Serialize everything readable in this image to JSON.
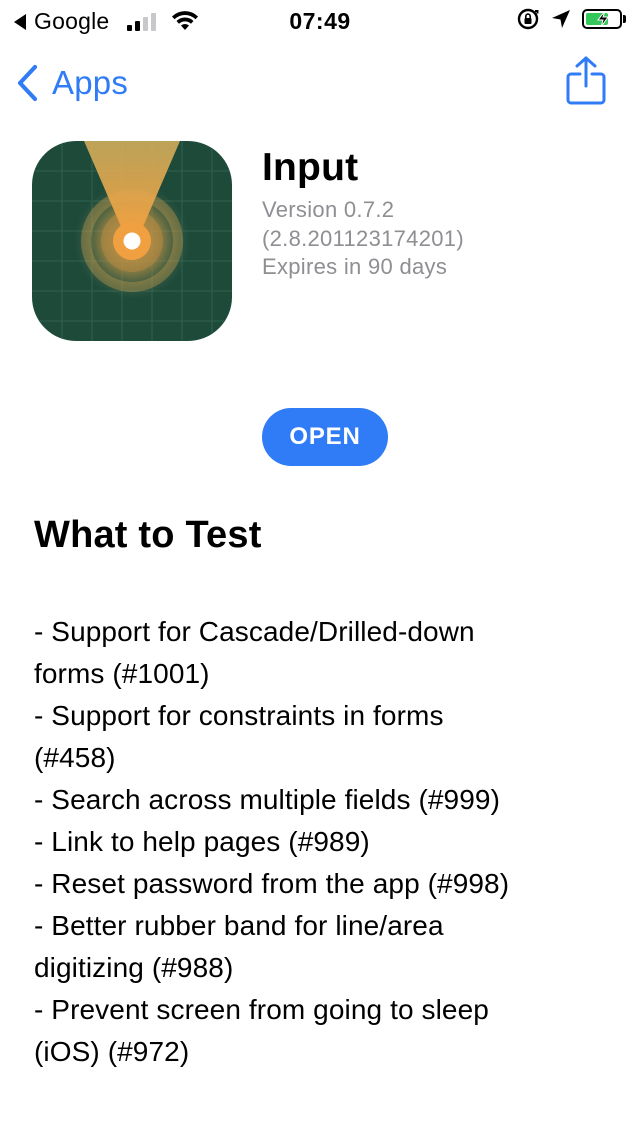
{
  "status_bar": {
    "back_app": "Google",
    "time": "07:49"
  },
  "nav": {
    "back_label": "Apps"
  },
  "app": {
    "name": "Input",
    "version": "Version 0.7.2",
    "build": "(2.8.201123174201)",
    "expires": "Expires in 90 days",
    "open_label": "OPEN"
  },
  "what_to_test": {
    "title": "What to Test",
    "lines": [
      "- Support for Cascade/Drilled-down",
      "forms (#1001)",
      "- Support for constraints in forms",
      "(#458)",
      "- Search across multiple fields (#999)",
      "- Link to help pages (#989)",
      "- Reset password from the app (#998)",
      "- Better rubber band for line/area",
      "digitizing (#988)",
      "- Prevent screen from going to sleep",
      "(iOS) (#972)"
    ]
  },
  "colors": {
    "accent": "#2f7cf6",
    "secondary_text": "#8e8e93",
    "battery_charge": "#34c759",
    "icon_bg": "#1e4a3a",
    "icon_glow": "#f0a040"
  },
  "icons": {
    "back": "chevron-left-icon",
    "share": "share-icon",
    "app": "input-app-icon"
  }
}
